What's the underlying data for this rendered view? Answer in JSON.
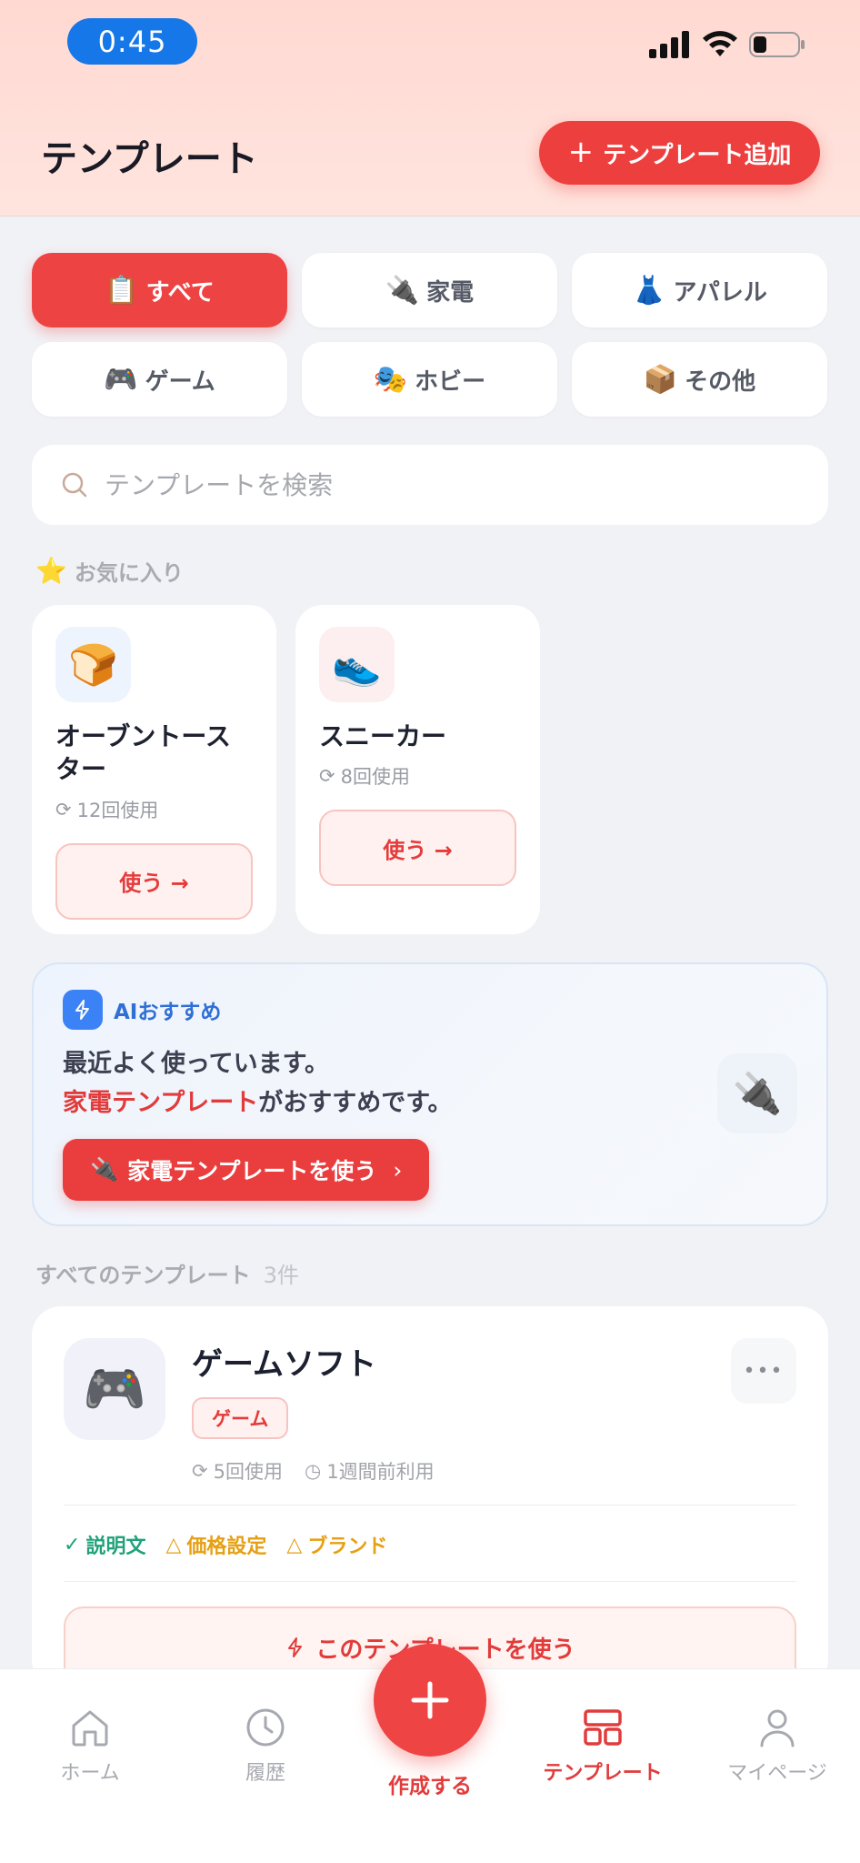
{
  "status_bar": {
    "time": "0:45"
  },
  "header": {
    "title": "テンプレート",
    "add_button_label": "テンプレート追加"
  },
  "categories": [
    {
      "emoji": "📋",
      "label": "すべて",
      "active": true
    },
    {
      "emoji": "🔌",
      "label": "家電",
      "active": false
    },
    {
      "emoji": "👗",
      "label": "アパレル",
      "active": false
    },
    {
      "emoji": "🎮",
      "label": "ゲーム",
      "active": false
    },
    {
      "emoji": "🎭",
      "label": "ホビー",
      "active": false
    },
    {
      "emoji": "📦",
      "label": "その他",
      "active": false
    }
  ],
  "search": {
    "placeholder": "テンプレートを検索"
  },
  "favorites": {
    "label": "お気に入り",
    "items": [
      {
        "emoji": "🍞",
        "name": "オーブントースター",
        "usage": "12回使用",
        "use_label": "使う →"
      },
      {
        "emoji": "👟",
        "name": "スニーカー",
        "usage": "8回使用",
        "use_label": "使う →"
      }
    ]
  },
  "ai": {
    "title": "AIおすすめ",
    "line1": "最近よく使っています。",
    "highlight": "家電テンプレート",
    "line2_rest": "がおすすめです。",
    "button_label": "家電テンプレートを使う",
    "button_emoji": "🔌",
    "side_emoji": "🔌"
  },
  "all_templates": {
    "label": "すべてのテンプレート",
    "count": "3件",
    "items": [
      {
        "emoji": "🎮",
        "name": "ゲームソフト",
        "tag": "ゲーム",
        "usage": "5回使用",
        "last_used": "1週間前利用",
        "checks": [
          {
            "label": "説明文",
            "status": "ok"
          },
          {
            "label": "価格設定",
            "status": "warn"
          },
          {
            "label": "ブランド",
            "status": "warn"
          }
        ],
        "use_label": "このテンプレートを使う"
      }
    ]
  },
  "bottom_nav": {
    "home": "ホーム",
    "history": "履歴",
    "create": "作成する",
    "templates": "テンプレート",
    "mypage": "マイページ"
  },
  "colors": {
    "accent": "#ee3f3f",
    "ai_blue": "#3b82f6",
    "ok_green": "#1fa27a",
    "warn_amber": "#e6a014"
  }
}
